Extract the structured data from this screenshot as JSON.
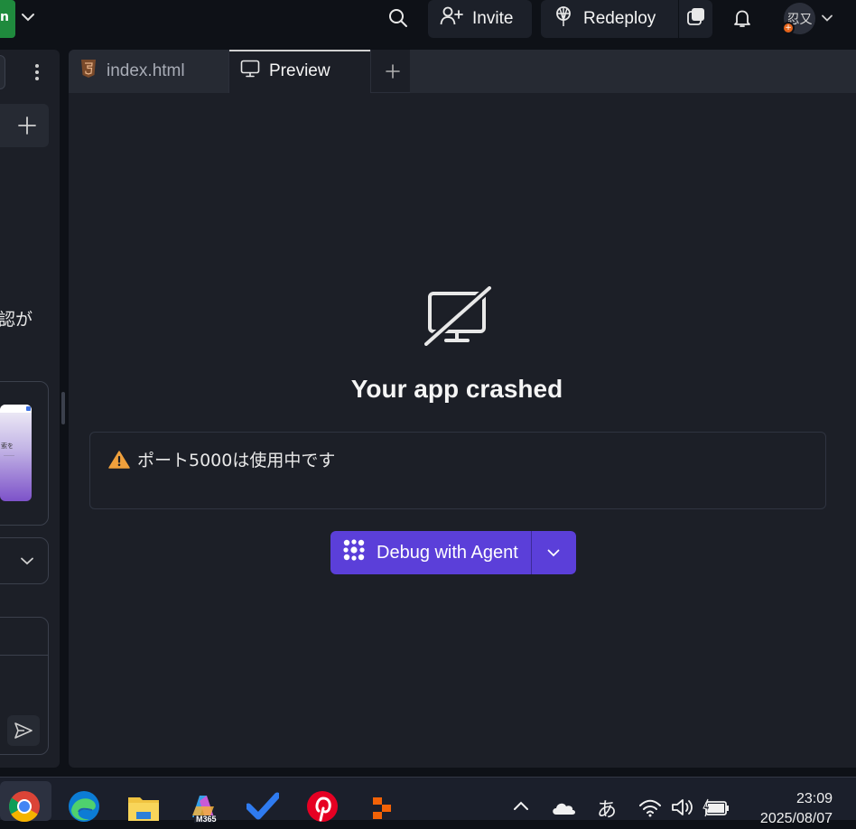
{
  "topbar": {
    "app_chip_text": "n",
    "invite_label": "Invite",
    "redeploy_label": "Redeploy",
    "avatar_initials": "忍又",
    "avatar_badge": "+"
  },
  "left_panel": {
    "partial_text": "認が",
    "thumbnail_text_1": "索を",
    "thumbnail_text_2": "……"
  },
  "tabs": [
    {
      "label": "index.html",
      "icon": "html5-icon",
      "active": false
    },
    {
      "label": "Preview",
      "icon": "monitor-icon",
      "active": true
    }
  ],
  "preview": {
    "icon": "monitor-off-icon",
    "title": "Your app crashed",
    "error_message": "ポート5000は使用中です",
    "error_icon": "warning-icon",
    "debug_label": "Debug with Agent"
  },
  "taskbar": {
    "apps": [
      "chrome-icon",
      "edge-icon",
      "file-explorer-icon",
      "m365-copilot-icon",
      "todo-icon",
      "pinterest-icon",
      "replit-icon"
    ],
    "m365_label": "M365",
    "ime_indicator": "あ",
    "time": "23:09",
    "date": "2025/08/07"
  },
  "colors": {
    "accent": "#5b3fd9",
    "warning": "#f0a03c",
    "background": "#1c1f27",
    "html5": "#e34c26"
  }
}
